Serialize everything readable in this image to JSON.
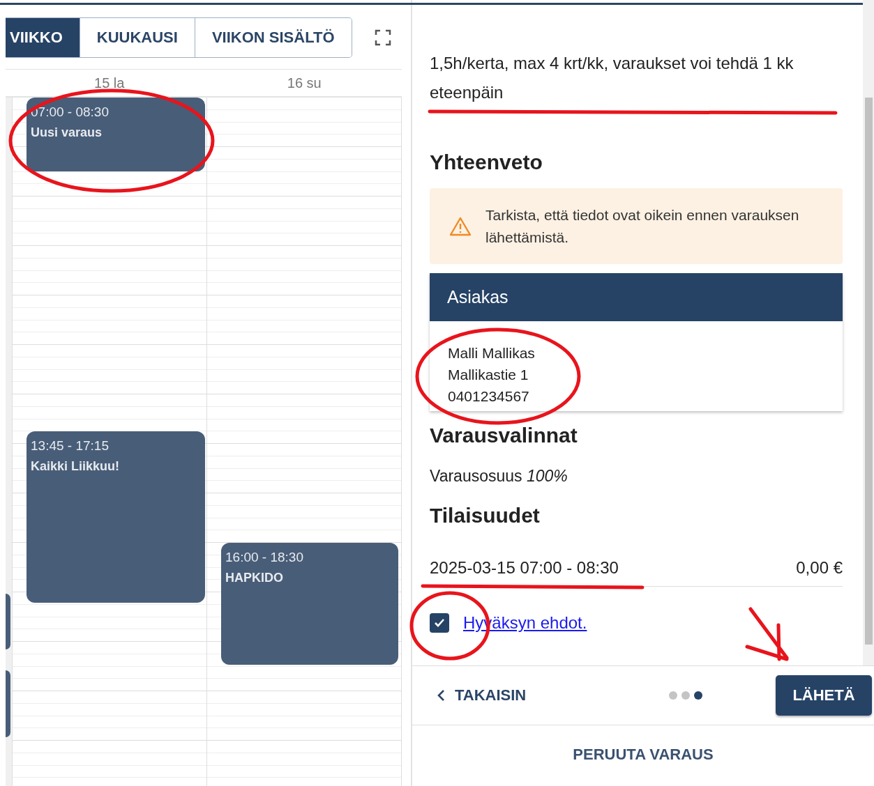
{
  "view_tabs": [
    {
      "label": "VIIKKO",
      "selected": true
    },
    {
      "label": "KUUKAUSI",
      "selected": false
    },
    {
      "label": "VIIKON SISÄLTÖ",
      "selected": false
    }
  ],
  "calendar": {
    "days": [
      {
        "label": "15 la",
        "events": [
          {
            "time": "07:00 - 08:30",
            "title": "Uusi varaus"
          },
          {
            "time": "13:45 - 17:15",
            "title": "Kaikki Liikkuu!"
          }
        ]
      },
      {
        "label": "16 su",
        "events": [
          {
            "time": "16:00 - 18:30",
            "title": "HAPKIDO"
          }
        ]
      }
    ]
  },
  "panel": {
    "info": "1,5h/kerta, max 4 krt/kk, varaukset voi tehdä 1 kk eteenpäin",
    "summary_heading": "Yhteenveto",
    "warning": "Tarkista, että tiedot ovat oikein ennen varauksen lähettämistä.",
    "customer": {
      "header": "Asiakas",
      "lines": [
        "Malli Mallikas",
        "Mallikastie 1",
        "0401234567"
      ]
    },
    "options_heading": "Varausvalinnat",
    "share": "Varausosuus *100%*",
    "occasions_heading": "Tilaisuudet",
    "occasions": [
      {
        "time": "2025-03-15 07:00 - 08:30",
        "price": "0,00 €"
      }
    ],
    "terms": {
      "label": "Hyväksyn ehdot.",
      "checked": true
    }
  },
  "footer": {
    "back": "TAKAISIN",
    "steps": [
      {
        "selected": false
      },
      {
        "selected": false
      },
      {
        "selected": true
      }
    ],
    "send": "LÄHETÄ",
    "cancel": "PERUUTA VARAUS"
  }
}
